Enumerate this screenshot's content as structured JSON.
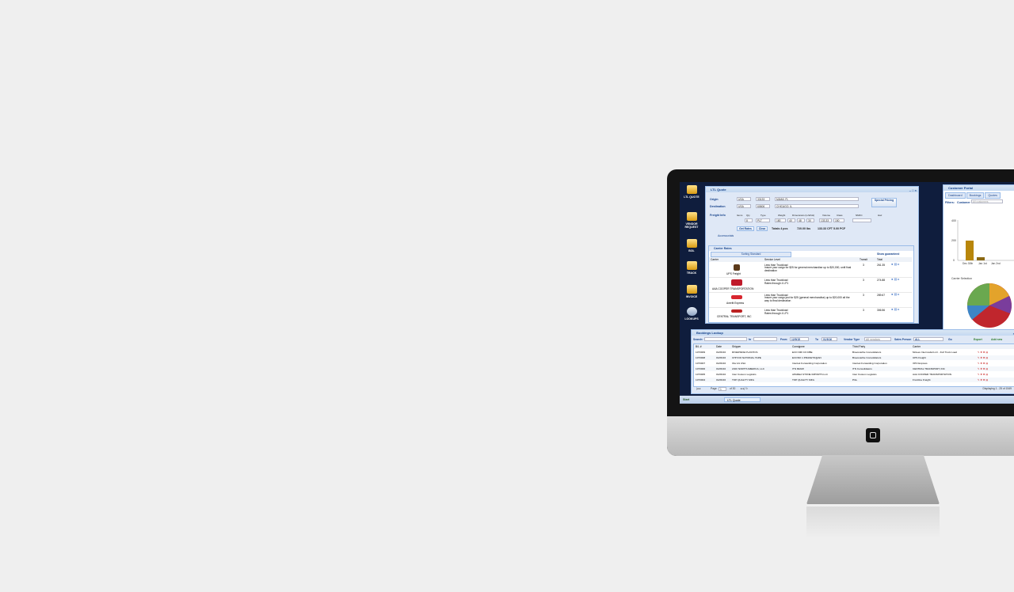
{
  "ltl_quote": {
    "title": "LTL Quote",
    "origin_label": "Origin",
    "origin_country": "USA",
    "origin_zip": "33133",
    "origin_city": "MIAMI, FL",
    "destination_label": "Destination",
    "destination_country": "USA",
    "destination_zip": "60606",
    "destination_city": "CHICAGO, IL",
    "special_pricing": "Special Pricing",
    "freight_info_label": "Freight Info",
    "freight_fields": [
      "Items",
      "Qty",
      "Type",
      "Weight",
      "Dimensions (LxWxH)",
      "Volume",
      "Class",
      "NMFC",
      "Haz"
    ],
    "freight_values": [
      "8",
      "PLT",
      "180",
      "40",
      "48",
      "30",
      "133.33",
      "150"
    ],
    "get_rates": "Get Rates",
    "clear": "Clear",
    "totals": "Totals 4 pcs",
    "weight_total": "720.00 lbs",
    "volume_total": "133.33 CFT 5.00 PCF",
    "accessorials": "Accessorials",
    "carrier_rates_title": "Carrier Rates",
    "sorting_label": "Sorting Standard",
    "guaranteed": "Show guaranteed",
    "columns": [
      "Carrier",
      "Service Level",
      "Transit",
      "Total"
    ],
    "rates": [
      {
        "carrier": "UPS Freight",
        "service": "Less than Truckload",
        "note": "Insure your cargo for $25 for general merchandise up to $20,000, until final destination",
        "transit": "3",
        "total": "261.35"
      },
      {
        "carrier": "AAA COOPER TRANSPORTATION",
        "service": "Less than Truckload",
        "note": "Rates through 4 LP1",
        "transit": "3",
        "total": "274.88"
      },
      {
        "carrier": "Averitt Express",
        "service": "Less than Truckload",
        "note": "Insure your cargo just for $25 (general merchandise) up to $20,000 all the way to final destination",
        "transit": "3",
        "total": "289.67"
      },
      {
        "carrier": "CENTRAL TRANSPORT, INC",
        "service": "Less than Truckload",
        "note": "Rates through 4 LP1",
        "transit": "3",
        "total": "306.56"
      }
    ]
  },
  "nav": [
    {
      "label": "LTL QUOTE"
    },
    {
      "label": "VENDOR REQUEST"
    },
    {
      "label": "BOL"
    },
    {
      "label": "TRACK"
    },
    {
      "label": "INVOICE"
    },
    {
      "label": "LOOKUPS"
    }
  ],
  "portal": {
    "title": "Customer Portal",
    "tabs": [
      "Dashboard",
      "Bookings",
      "Quotes"
    ],
    "filters_label": "Filters:",
    "customer_label": "Customer",
    "customer_value": "All customers",
    "y_ticks": [
      "400",
      "200",
      "0"
    ],
    "x_labels": [
      "Dec 30th",
      "Jan 1st",
      "Jan 2nd"
    ],
    "carrier_selection": "Carrier Selection"
  },
  "bookings": {
    "title": "Bookings Lookup",
    "search_label": "Search:",
    "in_label": "In",
    "from_label": "From",
    "from_value": "12/9/15",
    "to_label": "To",
    "to_value": "01/9/16",
    "vendor_label": "Vendor Type",
    "vendor_value": "All vendors",
    "sales_label": "Sales Person",
    "sales_value": "ALL",
    "go": "Go",
    "export": "Export",
    "add_new": "Add new",
    "columns": [
      "B/L #",
      "Date",
      "Shipper",
      "Consignee",
      "Third Party",
      "Carrier"
    ],
    "rows": [
      [
        "1073009",
        "01/06/16",
        "RIVERSIDE PLASTICS",
        "ECO DRI CO DBE",
        "Bravocaribe Consolidators",
        "Mctees Intermodal LLC - Full Truck Load"
      ],
      [
        "1073008",
        "01/06/16",
        "CHH DO NATIONAL TAPE",
        "ECONO 1 PRAFETO@AN",
        "Bravocaribe Consolidators",
        "UPS Freight"
      ],
      [
        "1073007",
        "01/06/16",
        "Ola Vol USA",
        "Intertek Forwarding Corporation",
        "Intertek Forwarding Corporation",
        "XPO Express"
      ],
      [
        "1073006",
        "01/06/16",
        "ASKI NORTH AMERICA, LLC",
        "ITN MIAMI",
        "ITN Consolidators",
        "CENTRAL TRANSPORT, INC"
      ],
      [
        "1073005",
        "01/06/16",
        "Inter Custom Logistics",
        "APAREA STONE IMPORTS LLC",
        "Inter Custom Logistics",
        "AAA COOPER TRANSPORTATION"
      ],
      [
        "1073004",
        "01/06/16",
        "TOP QUALITY MFG",
        "TOP QUALITY MFG",
        "PGL",
        "Frontline Freight"
      ]
    ],
    "page_label": "Page",
    "page_value": "1",
    "of_label": "of 30",
    "displaying": "Displaying 1 - 25 of 1549"
  },
  "taskbar": {
    "start": "Start",
    "task": "LTL Quote"
  },
  "colors": {
    "background": "#efefef",
    "screen": "#0f1d3d",
    "window": "#dfe8f6",
    "accent": "#15428b"
  }
}
